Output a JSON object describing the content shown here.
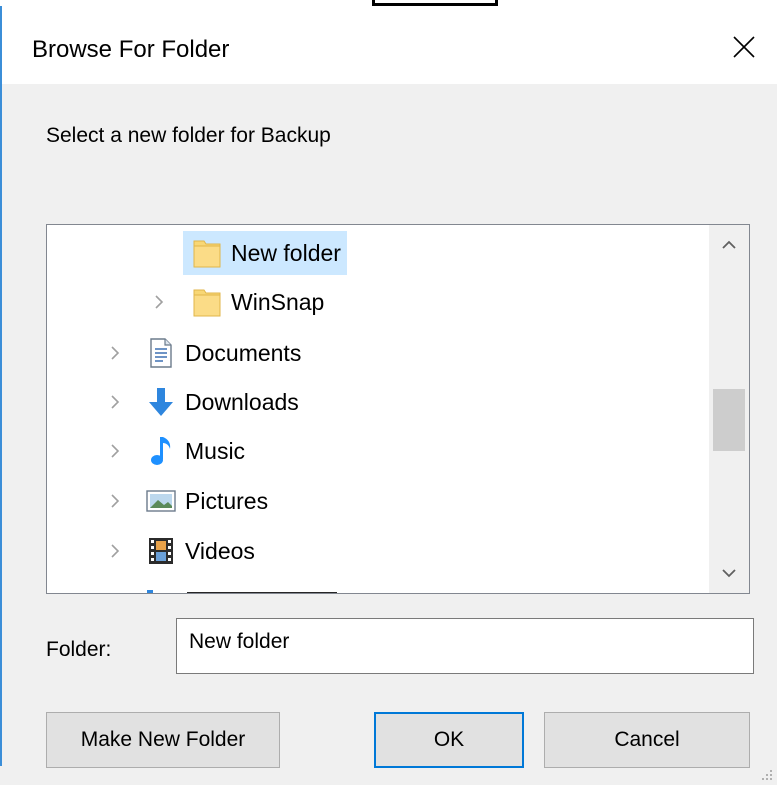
{
  "window": {
    "title": "Browse For Folder"
  },
  "prompt": "Select a new folder for Backup",
  "tree": {
    "items": [
      {
        "label": "New folder",
        "icon": "folder-icon",
        "expandable": false,
        "selected": true
      },
      {
        "label": "WinSnap",
        "icon": "folder-icon",
        "expandable": true,
        "selected": false
      },
      {
        "label": "Documents",
        "icon": "documents-icon",
        "expandable": true,
        "selected": false
      },
      {
        "label": "Downloads",
        "icon": "downloads-icon",
        "expandable": true,
        "selected": false
      },
      {
        "label": "Music",
        "icon": "music-icon",
        "expandable": true,
        "selected": false
      },
      {
        "label": "Pictures",
        "icon": "pictures-icon",
        "expandable": true,
        "selected": false
      },
      {
        "label": "Videos",
        "icon": "videos-icon",
        "expandable": true,
        "selected": false
      }
    ],
    "scroll_position": 0.55
  },
  "folder_field": {
    "label": "Folder:",
    "value": "New folder"
  },
  "buttons": {
    "make_new_folder": "Make New Folder",
    "ok": "OK",
    "cancel": "Cancel"
  },
  "colors": {
    "selection": "#cce8ff",
    "accent": "#0078d7",
    "folder": "#f8d775"
  }
}
